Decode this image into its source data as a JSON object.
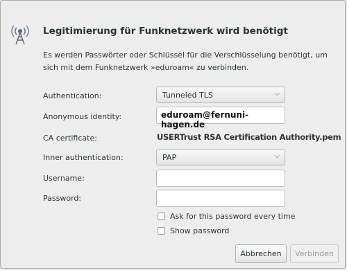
{
  "dialog": {
    "title": "Legitimierung für Funknetzwerk wird benötigt",
    "description": "Es werden Passwörter oder Schlüssel für die Verschlüsselung benötigt, um sich mit dem Funknetzwerk »eduroam« zu verbinden.",
    "icon": "wireless-antenna-icon"
  },
  "form": {
    "authentication": {
      "label": "Authentication:",
      "value": "Tunneled TLS"
    },
    "anonymous_identity": {
      "label": "Anonymous identity:",
      "value": "eduroam@fernuni-hagen.de"
    },
    "ca_certificate": {
      "label": "CA certificate:",
      "value": "USERTrust RSA Certification Authority.pem"
    },
    "inner_authentication": {
      "label": "Inner authentication:",
      "value": "PAP"
    },
    "username": {
      "label": "Username:",
      "value": ""
    },
    "password": {
      "label": "Password:",
      "value": ""
    },
    "ask_password": {
      "label": "Ask for this password every time",
      "checked": false
    },
    "show_password": {
      "label": "Show password",
      "checked": false
    }
  },
  "buttons": {
    "cancel": "Abbrechen",
    "connect": "Verbinden"
  }
}
